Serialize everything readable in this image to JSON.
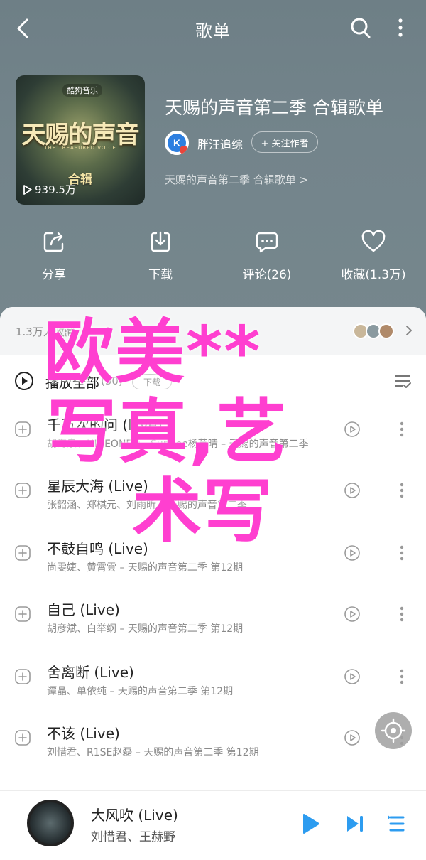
{
  "header": {
    "title": "歌单"
  },
  "playlist": {
    "cover_brand": "酷狗音乐",
    "cover_logo": "天赐的声音",
    "cover_logo_sub": "THE TREASURED VOICE",
    "cover_badge": "合辑",
    "plays": "939.5万",
    "title": "天赐的声音第二季 合辑歌单",
    "creator": "胖汪追综",
    "follow_label": "+ 关注作者",
    "description": "天赐的声音第二季 合辑歌单 >"
  },
  "actions": [
    {
      "label": "分享",
      "icon": "share-icon"
    },
    {
      "label": "下载",
      "icon": "download-icon"
    },
    {
      "label": "评论(26)",
      "icon": "comment-icon"
    },
    {
      "label": "收藏(1.3万)",
      "icon": "heart-icon"
    }
  ],
  "collectors": {
    "text": "1.3万人收藏"
  },
  "play_all": {
    "label": "播放全部",
    "count": "(50)",
    "download": "下载"
  },
  "songs": [
    {
      "title": "千万次的问 (Live)",
      "subtitle": "胡海泉、NINEONE#、Sunnee杨芸晴 – 天赐的声音第二季"
    },
    {
      "title": "星辰大海 (Live)",
      "subtitle": "张韶涵、郑棋元、刘雨昕 – 天赐的声音第二季"
    },
    {
      "title": "不鼓自鸣 (Live)",
      "subtitle": "尚雯婕、黄霄雲 – 天赐的声音第二季 第12期"
    },
    {
      "title": "自己 (Live)",
      "subtitle": "胡彦斌、白举纲 – 天赐的声音第二季 第12期"
    },
    {
      "title": "舍离断 (Live)",
      "subtitle": "谭晶、单依纯 – 天赐的声音第二季 第12期"
    },
    {
      "title": "不该 (Live)",
      "subtitle": "刘惜君、R1SE赵磊 – 天赐的声音第二季 第12期"
    }
  ],
  "now_playing": {
    "title": "大风吹 (Live)",
    "artist": "刘惜君、王赫野"
  },
  "overlay": {
    "line1": "欧美**",
    "line2": "写真,艺",
    "line3": "术写"
  },
  "colors": {
    "hero": "#73848b",
    "accent": "#2d9cf0",
    "overlay": "#ff3fd0"
  }
}
